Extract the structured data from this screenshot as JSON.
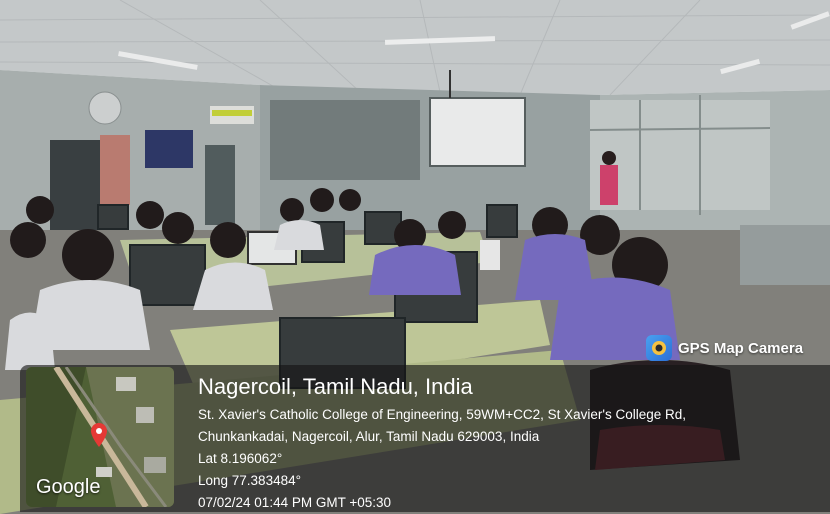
{
  "overlay": {
    "badge_label": "GPS Map Camera",
    "map_attribution": "Google",
    "title": "Nagercoil, Tamil Nadu, India",
    "address_line1": "St. Xavier's Catholic College of Engineering, 59WM+CC2, St Xavier's College Rd,",
    "address_line2": "Chunkankadai, Nagercoil, Alur, Tamil Nadu 629003, India",
    "lat": "Lat 8.196062°",
    "long": "Long 77.383484°",
    "timestamp": "07/02/24 01:44 PM GMT +05:30",
    "pin_color": "#e53935",
    "icon": "gps-map-camera-icon"
  },
  "scene": {
    "subject": "computer lab classroom with students seated at monitors facing a projector screen",
    "ceiling_color": "#cfd3d6",
    "wall_color": "#b9c0bf",
    "floor_color": "#8b8a82"
  }
}
